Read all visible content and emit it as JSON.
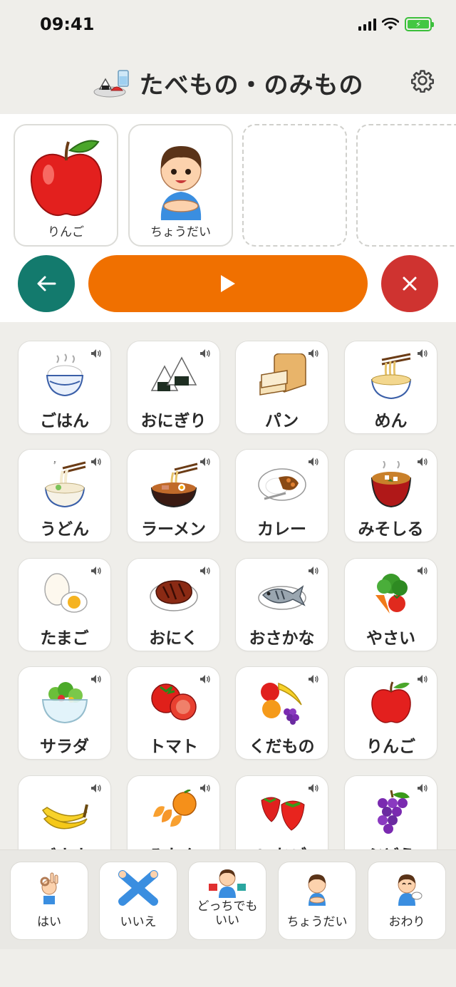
{
  "status_bar": {
    "time": "09:41"
  },
  "header": {
    "title": "たべもの・のみもの",
    "settings_icon": "gear-icon",
    "category_icon": "food-tray-icon"
  },
  "sentence": {
    "slots": [
      {
        "label": "りんご",
        "icon": "apple-icon"
      },
      {
        "label": "ちょうだい",
        "icon": "boy-asking-icon"
      },
      {
        "label": "",
        "empty": true
      },
      {
        "label": "",
        "empty": true
      }
    ],
    "back_icon": "arrow-left-icon",
    "play_icon": "play-icon",
    "clear_icon": "close-icon"
  },
  "grid": {
    "cards": [
      {
        "label": "ごはん",
        "icon": "rice-bowl-icon"
      },
      {
        "label": "おにぎり",
        "icon": "onigiri-icon"
      },
      {
        "label": "パン",
        "icon": "bread-icon"
      },
      {
        "label": "めん",
        "icon": "noodles-icon"
      },
      {
        "label": "うどん",
        "icon": "udon-icon"
      },
      {
        "label": "ラーメン",
        "icon": "ramen-icon"
      },
      {
        "label": "カレー",
        "icon": "curry-icon"
      },
      {
        "label": "みそしる",
        "icon": "miso-soup-icon"
      },
      {
        "label": "たまご",
        "icon": "egg-icon"
      },
      {
        "label": "おにく",
        "icon": "steak-icon"
      },
      {
        "label": "おさかな",
        "icon": "fish-icon"
      },
      {
        "label": "やさい",
        "icon": "vegetables-icon"
      },
      {
        "label": "サラダ",
        "icon": "salad-icon"
      },
      {
        "label": "トマト",
        "icon": "tomato-icon"
      },
      {
        "label": "くだもの",
        "icon": "fruits-icon"
      },
      {
        "label": "りんご",
        "icon": "apple-icon"
      },
      {
        "label": "バナナ",
        "icon": "banana-icon"
      },
      {
        "label": "みかん",
        "icon": "mandarin-icon"
      },
      {
        "label": "いちご",
        "icon": "strawberry-icon"
      },
      {
        "label": "ぶどう",
        "icon": "grapes-icon"
      }
    ]
  },
  "quick_replies": [
    {
      "label": "はい",
      "icon": "ok-hand-icon"
    },
    {
      "label": "いいえ",
      "icon": "crossed-arms-icon"
    },
    {
      "label": "どっちでも\nいい",
      "icon": "boy-choosing-icon"
    },
    {
      "label": "ちょうだい",
      "icon": "boy-asking-icon"
    },
    {
      "label": "おわり",
      "icon": "boy-finished-icon"
    }
  ],
  "colors": {
    "back": "#137a6d",
    "play": "#f07000",
    "clear": "#cf3330"
  }
}
